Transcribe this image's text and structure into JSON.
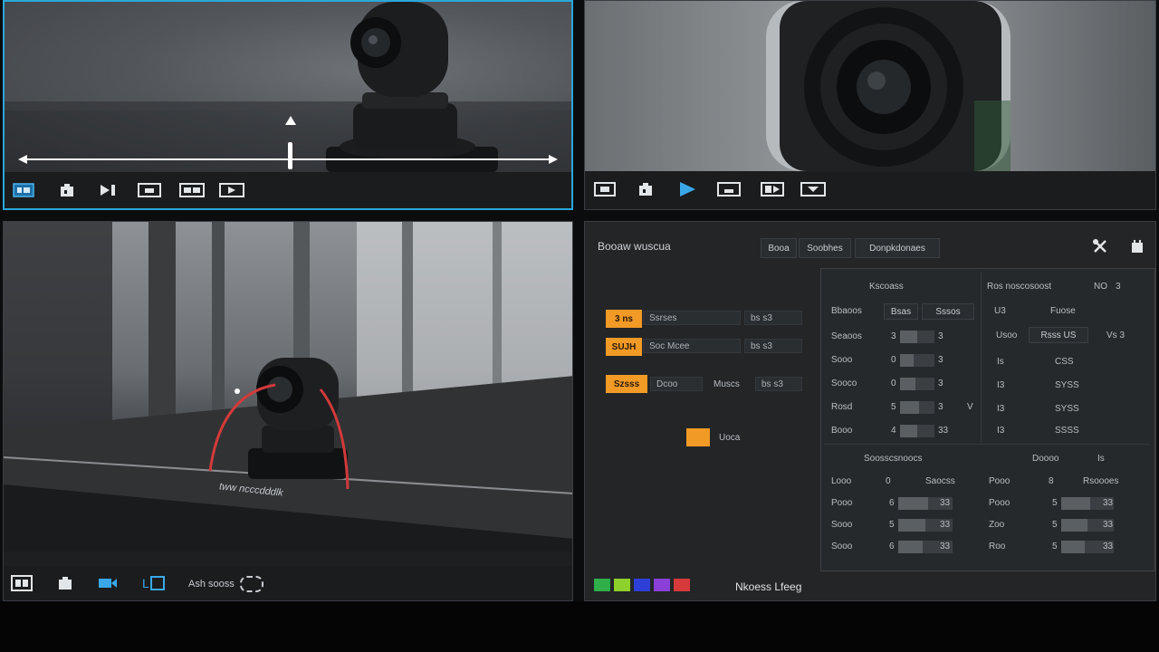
{
  "camera_views": {
    "top_left": {
      "toolbar": [
        {
          "icon": "screen-icon",
          "active": true
        },
        {
          "icon": "preset-icon"
        },
        {
          "icon": "skip-icon"
        },
        {
          "icon": "frame-icon"
        },
        {
          "icon": "record-icon"
        },
        {
          "icon": "film-icon"
        }
      ]
    },
    "top_right": {
      "toolbar": [
        {
          "icon": "screen-icon"
        },
        {
          "icon": "preset-icon"
        },
        {
          "icon": "play-icon",
          "active": true
        },
        {
          "icon": "frame-icon"
        },
        {
          "icon": "record-icon"
        },
        {
          "icon": "film-icon"
        }
      ]
    },
    "bottom_left": {
      "overlay_text": "tww ncccdddlk",
      "toolbar": {
        "icons": [
          "grid-icon",
          "preset-icon",
          "camera-icon",
          "layout-icon"
        ],
        "status_text": "Ash sooss"
      }
    }
  },
  "control_panel": {
    "title": "Booaw wuscua",
    "tabs": [
      "Booa",
      "Soobhes",
      "Donpkdonaes"
    ],
    "header_icons": [
      "tools-icon",
      "settings-icon"
    ],
    "quick_rows": [
      {
        "button": "3 ns",
        "label": "Ssrses",
        "value": "bs s3"
      },
      {
        "button": "SUJH",
        "label": "Soc Mcee",
        "value": "bs s3"
      },
      {
        "button": "Szsss",
        "label": "Dcoo",
        "value": "bs s3",
        "extra": "Muscs"
      }
    ],
    "single_button": {
      "button": "",
      "label": "Uoca"
    },
    "status_swatches": [
      "#2fae4a",
      "#8fd12c",
      "#2d3fd6",
      "#8a3fd6",
      "#d63a3a"
    ],
    "status_text": "Nkoess Lfeeg",
    "table_left": {
      "header": "Kscoass",
      "subheader": [
        "Bbaoos",
        "Bsas",
        "Sssos"
      ],
      "rows": [
        {
          "label": "Seaoos",
          "num": "3",
          "value": "3"
        },
        {
          "label": "Sooo",
          "num": "0",
          "value": "3"
        },
        {
          "label": "Sooco",
          "num": "0",
          "value": "3"
        },
        {
          "label": "Rosd",
          "num": "5",
          "value": "3"
        },
        {
          "label": "Booo",
          "num": "4",
          "value": "33"
        }
      ],
      "trailing": "V"
    },
    "table_right": {
      "header": "Ros noscosoost",
      "header_values": [
        "NO",
        "3"
      ],
      "subheader": [
        "U3",
        "Fuose"
      ],
      "sub2": [
        "Usoo",
        "Rsss US",
        "Vs 3"
      ],
      "rows": [
        {
          "num": "Is",
          "value": "CSS"
        },
        {
          "num": "I3",
          "value": "SYSS"
        },
        {
          "num": "I3",
          "value": "SYSS"
        },
        {
          "num": "I3",
          "value": "SSSS"
        }
      ]
    },
    "table_bottom_left": {
      "header": "Soosscsnoocs",
      "rows": [
        {
          "label": "Looo",
          "num": "0",
          "value": "Saocss"
        },
        {
          "label": "Pooo",
          "num": "6",
          "value": "33"
        },
        {
          "label": "Sooo",
          "num": "5",
          "value": "33"
        },
        {
          "label": "Sooo",
          "num": "6",
          "value": "33"
        }
      ]
    },
    "table_bottom_right": {
      "header": "Doooo",
      "header_value": "Is",
      "rows": [
        {
          "label": "Pooo",
          "num": "8",
          "value": "Rsoooes"
        },
        {
          "label": "Pooo",
          "num": "5",
          "value": "33"
        },
        {
          "label": "Zoo",
          "num": "5",
          "value": "33"
        },
        {
          "label": "Roo",
          "num": "5",
          "value": "33"
        }
      ]
    }
  }
}
